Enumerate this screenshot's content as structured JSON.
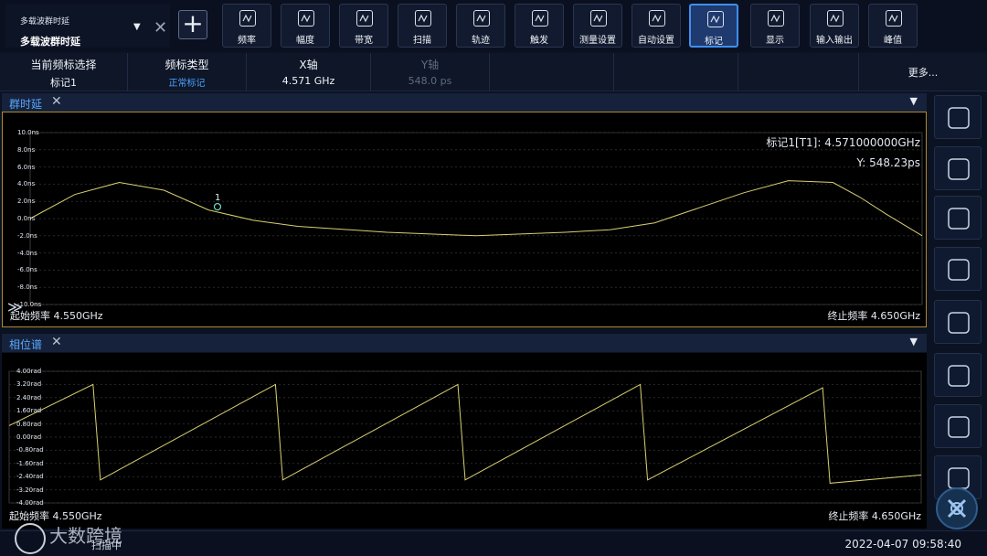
{
  "mode": {
    "small_label": "多载波群时延",
    "main_label": "多载波群时延"
  },
  "toolbar": [
    {
      "label": "频率",
      "icon": "waveform-icon"
    },
    {
      "label": "幅度",
      "icon": "bar-chart-icon"
    },
    {
      "label": "带宽",
      "icon": "bandwidth-icon"
    },
    {
      "label": "扫描",
      "icon": "sweep-icon"
    },
    {
      "label": "轨迹",
      "icon": "trace-icon"
    },
    {
      "label": "触发",
      "icon": "trigger-icon"
    },
    {
      "label": "测量设置",
      "icon": "ruler-icon"
    },
    {
      "label": "自动设置",
      "icon": "auto-icon"
    },
    {
      "label": "标记",
      "icon": "flag-icon"
    },
    {
      "label": "显示",
      "icon": "eye-icon"
    },
    {
      "label": "输入输出",
      "icon": "io-icon"
    },
    {
      "label": "峰值",
      "icon": "peak-icon"
    }
  ],
  "toolbar_active": "标记",
  "subbar": {
    "marker_select_title": "当前频标选择",
    "marker_select_value": "标记1",
    "marker_type_title": "频标类型",
    "marker_type_value": "正常标记",
    "x_title": "X轴",
    "x_value": "4.571 GHz",
    "y_title": "Y轴",
    "y_value": "548.0 ps",
    "more": "更多..."
  },
  "panel1": {
    "title": "群时延",
    "y_ticks": [
      "10.0ns",
      "8.0ns",
      "6.0ns",
      "4.0ns",
      "2.0ns",
      "0.0ns",
      "-2.0ns",
      "-4.0ns",
      "-6.0ns",
      "-8.0ns",
      "-10.0ns"
    ],
    "marker_label": "1",
    "marker_readout_x": "标记1[T1]:    4.571000000GHz",
    "marker_readout_y": "Y: 548.23ps",
    "start_freq": "起始频率 4.550GHz",
    "stop_freq": "终止频率 4.650GHz"
  },
  "panel2": {
    "title": "相位谱",
    "y_ticks": [
      "4.00rad",
      "3.20rad",
      "2.40rad",
      "1.60rad",
      "0.80rad",
      "0.00rad",
      "-0.80rad",
      "-1.60rad",
      "-2.40rad",
      "-3.20rad",
      "-4.00rad"
    ],
    "start_freq": "起始频率 4.550GHz",
    "stop_freq": "终止频率 4.650GHz"
  },
  "chart_data": [
    {
      "type": "line",
      "x": [
        4.55,
        4.555,
        4.56,
        4.565,
        4.57,
        4.575,
        4.58,
        4.59,
        4.6,
        4.61,
        4.615,
        4.62,
        4.63,
        4.635,
        4.64,
        4.643,
        4.646,
        4.65
      ],
      "y": [
        0.0,
        2.8,
        4.2,
        3.3,
        1.0,
        -0.2,
        -0.9,
        -1.6,
        -2.0,
        -1.6,
        -1.3,
        -0.5,
        3.0,
        4.4,
        4.2,
        2.5,
        0.5,
        -2.0
      ],
      "xlim": [
        4.55,
        4.65
      ],
      "ylim": [
        -10.0,
        10.0
      ],
      "grid": true,
      "color": "#d8d070"
    },
    {
      "type": "line",
      "x": [
        4.55,
        4.5592,
        4.56,
        4.5792,
        4.58,
        4.5992,
        4.6,
        4.6192,
        4.62,
        4.6392,
        4.64,
        4.65
      ],
      "y": [
        0.7,
        3.2,
        -2.6,
        3.2,
        -2.6,
        3.2,
        -2.6,
        3.2,
        -2.6,
        3.0,
        -2.8,
        -2.3
      ],
      "xlim": [
        4.55,
        4.65
      ],
      "ylim": [
        -4.0,
        4.0
      ],
      "grid": true,
      "color": "#d8d070"
    }
  ],
  "right_buttons": [
    {
      "icon": "scope-icon"
    },
    {
      "icon": "forward-icon"
    },
    {
      "icon": "refresh-icon"
    },
    {
      "icon": "save-icon"
    },
    {
      "icon": "folder-icon"
    },
    {
      "icon": "screen-icon"
    },
    {
      "icon": "print-icon"
    },
    {
      "icon": "scpi-icon"
    }
  ],
  "status": {
    "text": "扫描中",
    "time": "2022-04-07 09:58:40"
  },
  "watermark": "大数跨境"
}
